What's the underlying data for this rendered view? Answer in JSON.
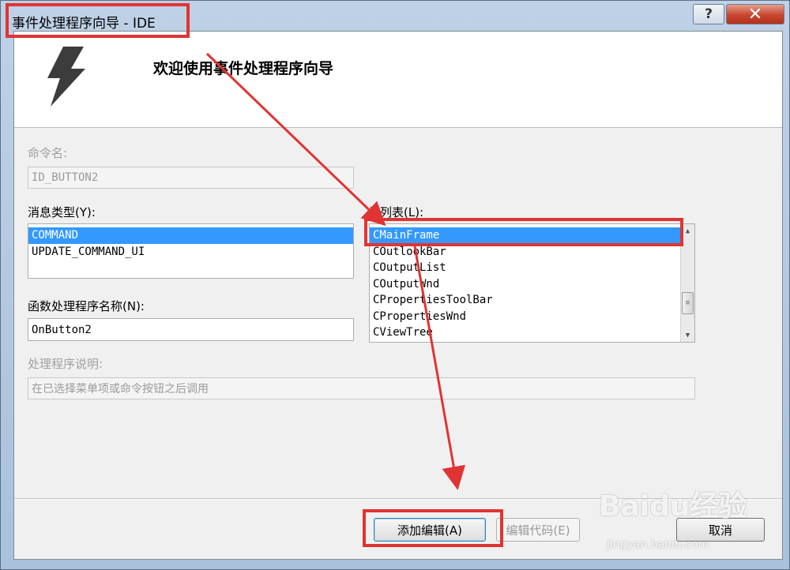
{
  "window": {
    "title": "事件处理程序向导 - IDE",
    "help_label": "?",
    "close_label": "✕"
  },
  "header": {
    "heading": "欢迎使用事件处理程序向导",
    "icon": "lightning-bolt-icon"
  },
  "form": {
    "command_name_label": "命令名:",
    "command_name_value": "ID_BUTTON2",
    "message_type_label": "消息类型(Y):",
    "message_types": [
      "COMMAND",
      "UPDATE_COMMAND_UI"
    ],
    "message_type_selected": "COMMAND",
    "class_list_label": "类列表(L):",
    "class_list": [
      "CMainFrame",
      "COutlookBar",
      "COutputList",
      "COutputWnd",
      "CPropertiesToolBar",
      "CPropertiesWnd",
      "CViewTree"
    ],
    "class_list_selected": "CMainFrame",
    "handler_name_label": "函数处理程序名称(N):",
    "handler_name_value": "OnButton2",
    "handler_desc_label": "处理程序说明:",
    "handler_desc_value": "在已选择菜单项或命令按钮之后调用"
  },
  "buttons": {
    "add_edit": "添加编辑(A)",
    "edit_code": "编辑代码(E)",
    "cancel": "取消"
  },
  "colors": {
    "selection": "#3399ff",
    "annotation": "#e03434"
  },
  "watermark": {
    "brand": "Baidu经验",
    "url": "jingyan.baidu.com"
  }
}
